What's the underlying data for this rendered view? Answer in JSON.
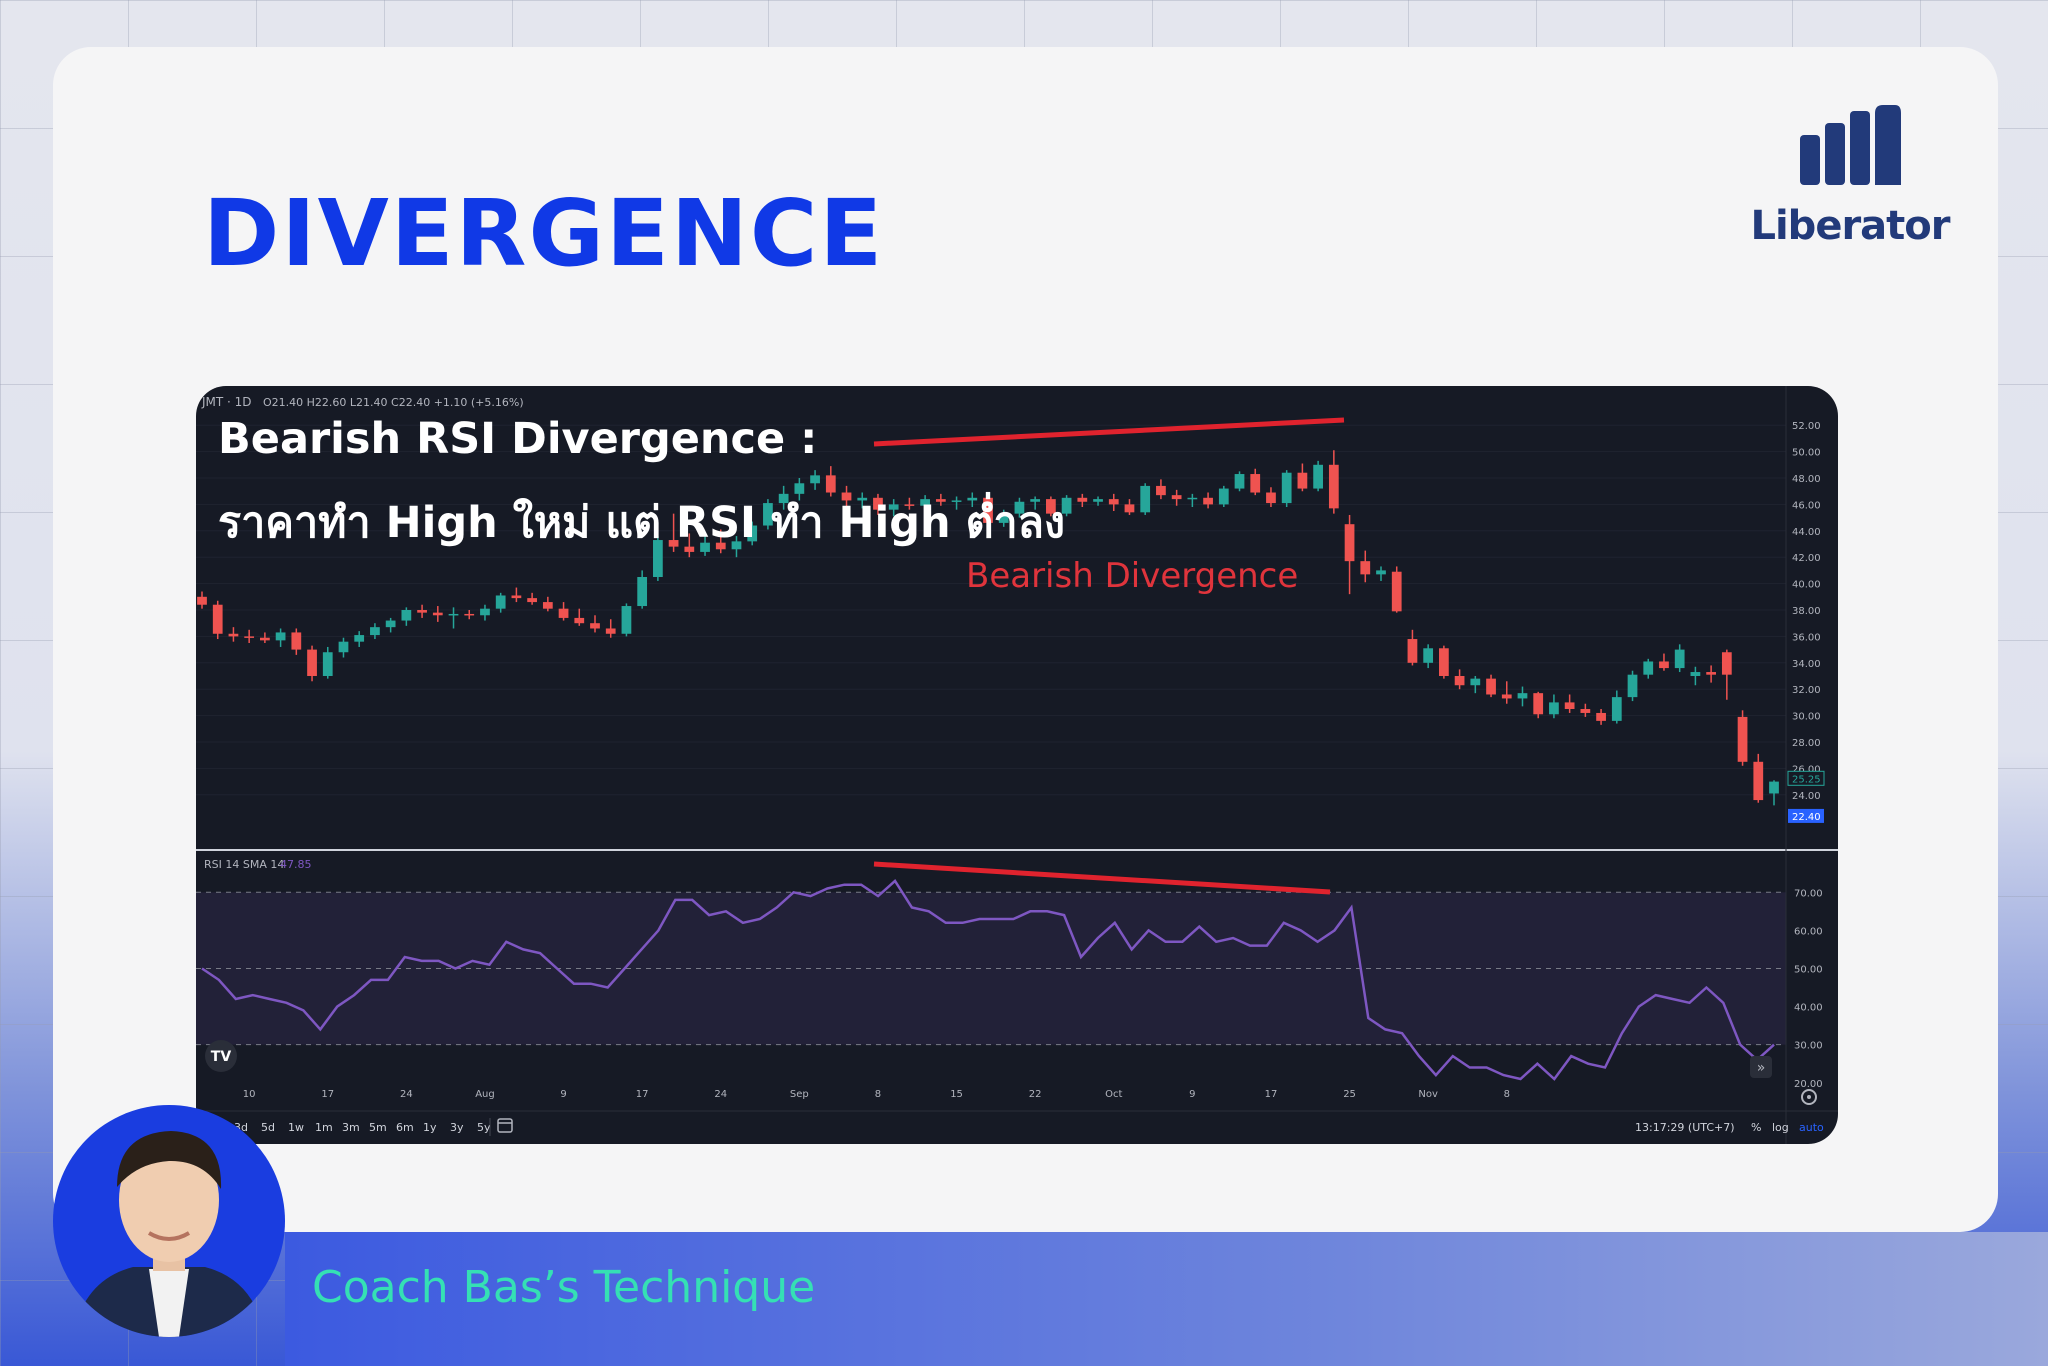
{
  "slide": {
    "title": "DIVERGENCE",
    "brand": "Liberator",
    "footer": "Coach Bas’s Technique"
  },
  "overlay": {
    "headline": "Bearish RSI Divergence :",
    "subline": "ราคาทำ High ใหม่ แต่ RSI ทำ High ต่ำลง",
    "annotation": "Bearish Divergence"
  },
  "chart_header": {
    "symbol": "JMT · 1D",
    "ohlc": "O21.40 H22.60 L21.40 C22.40 +1.10 (+5.16%)",
    "rsi_legend": "RSI 14 SMA 14",
    "rsi_value": "47.85"
  },
  "bottom_bar": {
    "ranges": [
      "3d",
      "5d",
      "1w",
      "1m",
      "3m",
      "5m",
      "6m",
      "1y",
      "3y",
      "5y"
    ],
    "clock": "13:17:29 (UTC+7)",
    "percent": "%",
    "log": "log",
    "auto": "auto"
  },
  "colors": {
    "up": "#26a69a",
    "down": "#ef5350",
    "rsi": "#7e57c2",
    "trendline": "#e0232e",
    "title": "#1039e6",
    "footer_text": "#35e0b4"
  },
  "icons": [
    "tradingview-logo-icon",
    "calendar-range-icon",
    "scroll-right-icon",
    "settings-icon",
    "liberator-logo-icon"
  ],
  "chart_data": [
    {
      "type": "candlestick",
      "title": "JMT · 1D",
      "x_ticks": [
        "10",
        "17",
        "24",
        "Aug",
        "9",
        "17",
        "24",
        "Sep",
        "8",
        "15",
        "22",
        "Oct",
        "9",
        "17",
        "25",
        "Nov",
        "8"
      ],
      "y_ticks": [
        "52.00",
        "50.00",
        "48.00",
        "46.00",
        "44.00",
        "42.00",
        "40.00",
        "38.00",
        "36.00",
        "34.00",
        "32.00",
        "30.00",
        "28.00",
        "26.00",
        "24.00"
      ],
      "ylim": [
        20.5,
        53
      ],
      "price_labels": [
        "25.25",
        "22.40"
      ],
      "ohlc": [
        [
          39.0,
          39.4,
          38.1,
          38.4
        ],
        [
          38.4,
          38.7,
          35.8,
          36.2
        ],
        [
          36.2,
          36.7,
          35.6,
          36.0
        ],
        [
          36.0,
          36.5,
          35.5,
          35.9
        ],
        [
          35.9,
          36.3,
          35.5,
          35.7
        ],
        [
          35.7,
          36.6,
          35.2,
          36.3
        ],
        [
          36.3,
          36.6,
          34.6,
          35.0
        ],
        [
          35.0,
          35.3,
          32.6,
          33.0
        ],
        [
          33.0,
          35.2,
          32.8,
          34.8
        ],
        [
          34.8,
          35.9,
          34.4,
          35.6
        ],
        [
          35.6,
          36.4,
          35.2,
          36.1
        ],
        [
          36.1,
          37.0,
          35.8,
          36.7
        ],
        [
          36.7,
          37.4,
          36.3,
          37.2
        ],
        [
          37.2,
          38.2,
          36.8,
          38.0
        ],
        [
          38.0,
          38.4,
          37.4,
          37.8
        ],
        [
          37.8,
          38.3,
          37.1,
          37.6
        ],
        [
          37.6,
          38.2,
          36.6,
          37.7
        ],
        [
          37.7,
          38.0,
          37.3,
          37.6
        ],
        [
          37.6,
          38.4,
          37.2,
          38.1
        ],
        [
          38.1,
          39.3,
          37.8,
          39.1
        ],
        [
          39.1,
          39.7,
          38.6,
          38.9
        ],
        [
          38.9,
          39.3,
          38.4,
          38.6
        ],
        [
          38.6,
          39.0,
          37.9,
          38.1
        ],
        [
          38.1,
          38.6,
          37.2,
          37.4
        ],
        [
          37.4,
          38.1,
          36.8,
          37.0
        ],
        [
          37.0,
          37.6,
          36.3,
          36.6
        ],
        [
          36.6,
          37.3,
          35.9,
          36.2
        ],
        [
          36.2,
          38.5,
          36.0,
          38.3
        ],
        [
          38.3,
          41.0,
          38.1,
          40.5
        ],
        [
          40.5,
          43.6,
          40.2,
          43.3
        ],
        [
          43.3,
          45.3,
          42.4,
          42.8
        ],
        [
          42.8,
          43.8,
          42.0,
          42.4
        ],
        [
          42.4,
          43.7,
          42.1,
          43.1
        ],
        [
          43.1,
          44.1,
          42.3,
          42.6
        ],
        [
          42.6,
          43.6,
          42.0,
          43.2
        ],
        [
          43.2,
          44.7,
          42.9,
          44.4
        ],
        [
          44.4,
          46.4,
          44.1,
          46.1
        ],
        [
          46.1,
          47.4,
          45.6,
          46.8
        ],
        [
          46.8,
          48.0,
          46.3,
          47.6
        ],
        [
          47.6,
          48.6,
          47.1,
          48.2
        ],
        [
          48.2,
          48.9,
          46.6,
          46.9
        ],
        [
          46.9,
          47.4,
          45.8,
          46.3
        ],
        [
          46.3,
          46.9,
          45.7,
          46.5
        ],
        [
          46.5,
          46.8,
          45.2,
          45.6
        ],
        [
          45.6,
          46.4,
          45.1,
          46.0
        ],
        [
          46.0,
          46.5,
          45.6,
          45.9
        ],
        [
          45.9,
          46.7,
          45.4,
          46.4
        ],
        [
          46.4,
          46.8,
          45.9,
          46.2
        ],
        [
          46.2,
          46.6,
          45.6,
          46.3
        ],
        [
          46.3,
          46.9,
          45.8,
          46.5
        ],
        [
          46.5,
          46.8,
          44.2,
          44.6
        ],
        [
          44.6,
          45.6,
          44.3,
          45.3
        ],
        [
          45.3,
          46.5,
          45.0,
          46.2
        ],
        [
          46.2,
          46.6,
          45.6,
          46.4
        ],
        [
          46.4,
          46.6,
          45.1,
          45.3
        ],
        [
          45.3,
          46.7,
          45.1,
          46.5
        ],
        [
          46.5,
          46.8,
          45.8,
          46.2
        ],
        [
          46.2,
          46.6,
          45.9,
          46.4
        ],
        [
          46.4,
          46.8,
          45.5,
          46.0
        ],
        [
          46.0,
          46.4,
          45.2,
          45.4
        ],
        [
          45.4,
          47.6,
          45.2,
          47.4
        ],
        [
          47.4,
          47.9,
          46.4,
          46.7
        ],
        [
          46.7,
          47.1,
          45.9,
          46.4
        ],
        [
          46.4,
          46.8,
          45.8,
          46.5
        ],
        [
          46.5,
          46.9,
          45.7,
          46.0
        ],
        [
          46.0,
          47.4,
          45.8,
          47.2
        ],
        [
          47.2,
          48.5,
          47.0,
          48.3
        ],
        [
          48.3,
          48.7,
          46.7,
          46.9
        ],
        [
          46.9,
          47.3,
          45.8,
          46.1
        ],
        [
          46.1,
          48.6,
          45.8,
          48.4
        ],
        [
          48.4,
          49.1,
          47.0,
          47.2
        ],
        [
          47.2,
          49.3,
          47.0,
          49.0
        ],
        [
          49.0,
          50.1,
          45.3,
          45.7
        ],
        [
          44.5,
          45.2,
          39.2,
          41.7
        ],
        [
          41.7,
          42.5,
          40.1,
          40.7
        ],
        [
          40.7,
          41.3,
          40.2,
          41.0
        ],
        [
          40.9,
          41.3,
          37.8,
          37.9
        ],
        [
          35.8,
          36.5,
          33.8,
          34.0
        ],
        [
          34.0,
          35.4,
          33.6,
          35.1
        ],
        [
          35.1,
          35.3,
          32.8,
          33.0
        ],
        [
          33.0,
          33.5,
          32.0,
          32.3
        ],
        [
          32.3,
          33.0,
          31.7,
          32.8
        ],
        [
          32.8,
          33.1,
          31.4,
          31.6
        ],
        [
          31.6,
          32.6,
          30.9,
          31.3
        ],
        [
          31.3,
          32.2,
          30.7,
          31.7
        ],
        [
          31.7,
          31.8,
          29.8,
          30.1
        ],
        [
          30.1,
          31.6,
          29.8,
          31.0
        ],
        [
          31.0,
          31.6,
          30.2,
          30.5
        ],
        [
          30.5,
          30.9,
          29.9,
          30.2
        ],
        [
          30.2,
          30.5,
          29.3,
          29.6
        ],
        [
          29.6,
          31.9,
          29.4,
          31.4
        ],
        [
          31.4,
          33.4,
          31.1,
          33.1
        ],
        [
          33.1,
          34.3,
          32.8,
          34.1
        ],
        [
          34.1,
          34.7,
          33.4,
          33.6
        ],
        [
          33.6,
          35.4,
          33.3,
          35.0
        ],
        [
          33.0,
          33.7,
          32.3,
          33.3
        ],
        [
          33.3,
          33.8,
          32.5,
          33.1
        ],
        [
          34.8,
          35.0,
          31.2,
          33.1
        ],
        [
          29.9,
          30.4,
          26.2,
          26.5
        ],
        [
          26.5,
          27.1,
          23.4,
          23.6
        ],
        [
          24.1,
          25.1,
          23.2,
          25.0
        ]
      ]
    },
    {
      "type": "line",
      "title": "RSI 14 SMA 14",
      "y_ticks": [
        "70.00",
        "60.00",
        "50.00",
        "40.00",
        "30.00",
        "20.00"
      ],
      "ylim": [
        16,
        79
      ],
      "bands": [
        30,
        50,
        70
      ],
      "series": [
        {
          "name": "RSI 14",
          "values": [
            50,
            47,
            42,
            43,
            42,
            41,
            39,
            34,
            40,
            43,
            47,
            47,
            53,
            52,
            52,
            50,
            52,
            51,
            57,
            55,
            54,
            50,
            46,
            46,
            45,
            50,
            55,
            60,
            68,
            68,
            64,
            65,
            62,
            63,
            66,
            70,
            69,
            71,
            72,
            72,
            69,
            73,
            66,
            65,
            62,
            62,
            63,
            63,
            63,
            65,
            65,
            64,
            53,
            58,
            62,
            55,
            60,
            57,
            57,
            61,
            57,
            58,
            56,
            56,
            62,
            60,
            57,
            60,
            66,
            37,
            34,
            33,
            27,
            22,
            27,
            24,
            24,
            22,
            21,
            25,
            21,
            27,
            25,
            24,
            33,
            40,
            43,
            42,
            41,
            45,
            41,
            30,
            26,
            30
          ]
        }
      ]
    }
  ]
}
